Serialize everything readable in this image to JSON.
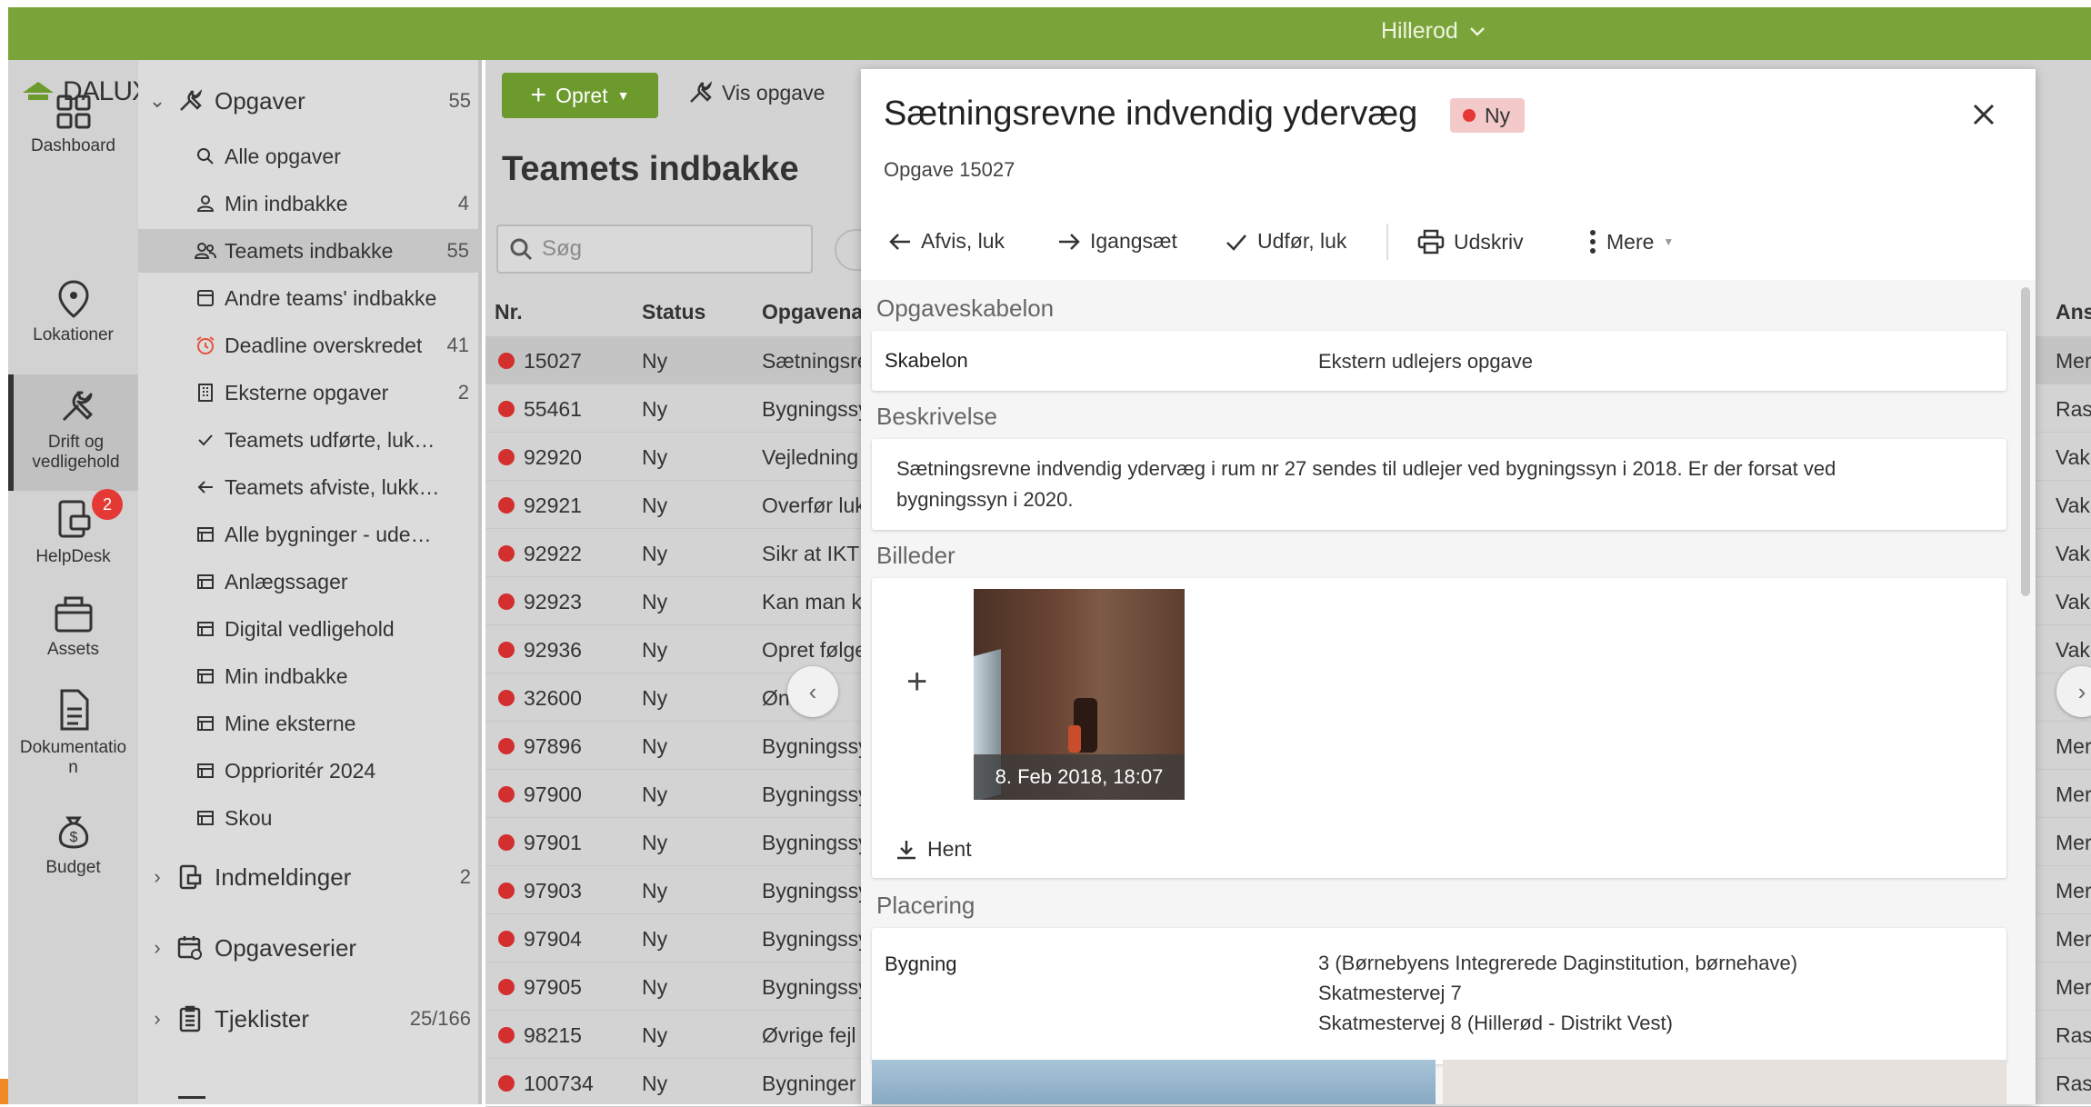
{
  "topbar": {
    "org": "Hillerod"
  },
  "rail": {
    "logo": "DALUX",
    "items": [
      {
        "label": "Dashboard",
        "icon": "grid-icon"
      },
      {
        "label": "Lokationer",
        "icon": "pin-icon"
      },
      {
        "label": "Drift og vedligehold",
        "icon": "wrench-icon"
      },
      {
        "label": "HelpDesk",
        "icon": "helpdesk-icon",
        "badge": "2"
      },
      {
        "label": "Assets",
        "icon": "box-icon"
      },
      {
        "label": "Dokumentation",
        "icon": "document-icon"
      },
      {
        "label": "Budget",
        "icon": "moneybag-icon"
      }
    ]
  },
  "nav": {
    "opgaver": {
      "label": "Opgaver",
      "count": "55"
    },
    "items": [
      {
        "label": "Alle opgaver",
        "count": ""
      },
      {
        "label": "Min indbakke",
        "count": "4"
      },
      {
        "label": "Teamets indbakke",
        "count": "55"
      },
      {
        "label": "Andre teams' indbakke",
        "count": ""
      },
      {
        "label": "Deadline overskredet",
        "count": "41"
      },
      {
        "label": "Eksterne opgaver",
        "count": "2"
      },
      {
        "label": "Teamets udførte, lukke…",
        "count": ""
      },
      {
        "label": "Teamets afviste, lukkede",
        "count": ""
      },
      {
        "label": "Alle bygninger - uden ta…",
        "count": ""
      },
      {
        "label": "Anlægssager",
        "count": ""
      },
      {
        "label": "Digital vedligehold",
        "count": ""
      },
      {
        "label": "Min indbakke",
        "count": ""
      },
      {
        "label": "Mine eksterne",
        "count": ""
      },
      {
        "label": "Opprioritér 2024",
        "count": ""
      },
      {
        "label": "Skou",
        "count": ""
      }
    ],
    "indmeldinger": {
      "label": "Indmeldinger",
      "count": "2"
    },
    "opgaveserier": {
      "label": "Opgaveserier",
      "count": ""
    },
    "tjeklister": {
      "label": "Tjeklister",
      "count": "25/166"
    }
  },
  "list": {
    "create_label": "Opret",
    "view_label": "Vis opgave",
    "title": "Teamets indbakke",
    "search_placeholder": "Søg",
    "columns": {
      "nr": "Nr.",
      "status": "Status",
      "name": "Opgavenav",
      "resp": "Ansv"
    },
    "rows": [
      {
        "nr": "15027",
        "status": "Ny",
        "name": "Sætningsre",
        "resp": "Mere"
      },
      {
        "nr": "55461",
        "status": "Ny",
        "name": "Bygningssy",
        "resp": "Rasn"
      },
      {
        "nr": "92920",
        "status": "Ny",
        "name": "Vejledning",
        "resp": "Vaka"
      },
      {
        "nr": "92921",
        "status": "Ny",
        "name": "Overfør luk",
        "resp": "Vaka"
      },
      {
        "nr": "92922",
        "status": "Ny",
        "name": "Sikr at IKT",
        "resp": "Vaka"
      },
      {
        "nr": "92923",
        "status": "Ny",
        "name": "Kan man k",
        "resp": "Vaka"
      },
      {
        "nr": "92936",
        "status": "Ny",
        "name": "Opret følge",
        "resp": "Vaka"
      },
      {
        "nr": "32600",
        "status": "Ny",
        "name": "Øn      m",
        "resp": ""
      },
      {
        "nr": "97896",
        "status": "Ny",
        "name": "Bygningssy",
        "resp": "Mere"
      },
      {
        "nr": "97900",
        "status": "Ny",
        "name": "Bygningssy",
        "resp": "Mere"
      },
      {
        "nr": "97901",
        "status": "Ny",
        "name": "Bygningssy",
        "resp": "Mere"
      },
      {
        "nr": "97903",
        "status": "Ny",
        "name": "Bygningssy",
        "resp": "Mere"
      },
      {
        "nr": "97904",
        "status": "Ny",
        "name": "Bygningssy",
        "resp": "Mere"
      },
      {
        "nr": "97905",
        "status": "Ny",
        "name": "Bygningssy",
        "resp": "Mere"
      },
      {
        "nr": "98215",
        "status": "Ny",
        "name": "Øvrige fejl",
        "resp": "Rasn"
      },
      {
        "nr": "100734",
        "status": "Ny",
        "name": "Bygninger",
        "resp": "Rasn"
      }
    ]
  },
  "panel": {
    "title": "Sætningsrevne indvendig ydervæg",
    "badge": "Ny",
    "subtitle": "Opgave 15027",
    "actions": {
      "reject": "Afvis, luk",
      "start": "Igangsæt",
      "done": "Udfør, luk",
      "print": "Udskriv",
      "more": "Mere"
    },
    "template": {
      "heading": "Opgaveskabelon",
      "key": "Skabelon",
      "value": "Ekstern udlejers opgave"
    },
    "description": {
      "heading": "Beskrivelse",
      "text": "Sætningsrevne indvendig ydervæg i rum nr 27 sendes til udlejer ved bygningssyn i 2018. Er der forsat ved bygningssyn i 2020."
    },
    "images": {
      "heading": "Billeder",
      "caption": "8. Feb 2018, 18:07",
      "download": "Hent"
    },
    "location": {
      "heading": "Placering",
      "key": "Bygning",
      "line1": "3 (Børnebyens Integrerede Daginstitution, børnehave)",
      "line2": "Skatmestervej 7",
      "line3": "Skatmestervej 8 (Hillerød - Distrikt Vest)"
    }
  },
  "colors": {
    "topbar": "#7aa33a",
    "create": "#6c9a2c",
    "status_dot": "#d32f2f",
    "badge_bg": "#f4c9c9"
  }
}
